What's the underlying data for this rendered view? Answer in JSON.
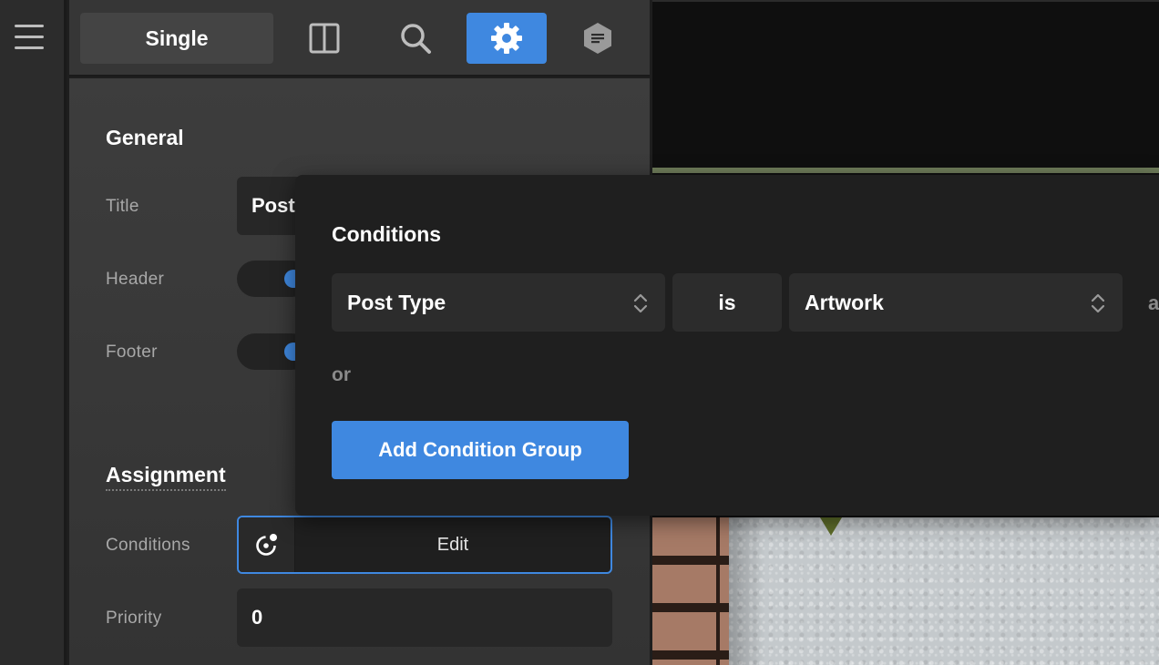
{
  "toolbar": {
    "mode_tab": "Single",
    "buttons": [
      {
        "icon": "columns-icon",
        "active": false
      },
      {
        "icon": "search-icon",
        "active": false
      },
      {
        "icon": "gear-icon",
        "active": true
      },
      {
        "icon": "layout-hexagon-icon",
        "active": false
      }
    ]
  },
  "general": {
    "heading": "General",
    "title_label": "Title",
    "title_value": "Post",
    "header_label": "Header",
    "header_enabled": true,
    "footer_label": "Footer",
    "footer_enabled": true
  },
  "assignment": {
    "heading": "Assignment",
    "conditions_label": "Conditions",
    "conditions_edit": "Edit",
    "priority_label": "Priority",
    "priority_value": "0"
  },
  "conditions_popover": {
    "heading": "Conditions",
    "rule": {
      "field": "Post Type",
      "operator": "is",
      "value": "Artwork",
      "trailing": "a"
    },
    "or_label": "or",
    "add_group_button": "Add Condition Group"
  },
  "colors": {
    "accent": "#3f88e0",
    "panel_bg": "#3a3a3a",
    "popover_bg": "#1f1f1f"
  }
}
